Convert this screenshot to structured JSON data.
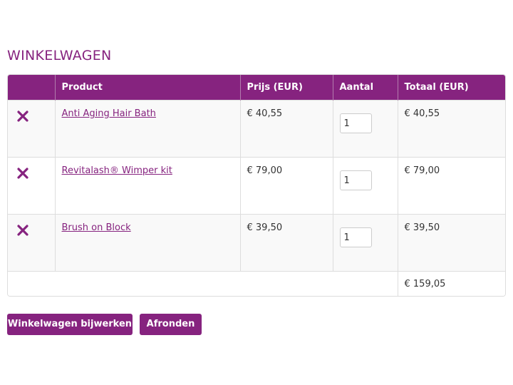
{
  "page": {
    "title": "WINKELWAGEN"
  },
  "colors": {
    "accent": "#86237f",
    "border": "#dddddd",
    "row_alt": "#f9f9f9"
  },
  "cart": {
    "columns": [
      "",
      "Product",
      "Prijs (EUR)",
      "Aantal",
      "Totaal (EUR)"
    ],
    "items": [
      {
        "remove_icon": "close-x-icon",
        "product": "Anti Aging Hair Bath",
        "price": "€ 40,55",
        "quantity": "1",
        "total": "€ 40,55"
      },
      {
        "remove_icon": "close-x-icon",
        "product": "Revitalash® Wimper kit",
        "price": "€ 79,00",
        "quantity": "1",
        "total": "€ 79,00"
      },
      {
        "remove_icon": "close-x-icon",
        "product": "Brush on Block",
        "price": "€ 39,50",
        "quantity": "1",
        "total": "€ 39,50"
      }
    ],
    "grand_total": "€ 159,05"
  },
  "actions": {
    "update_label": "Winkelwagen bijwerken",
    "checkout_label": "Afronden"
  }
}
